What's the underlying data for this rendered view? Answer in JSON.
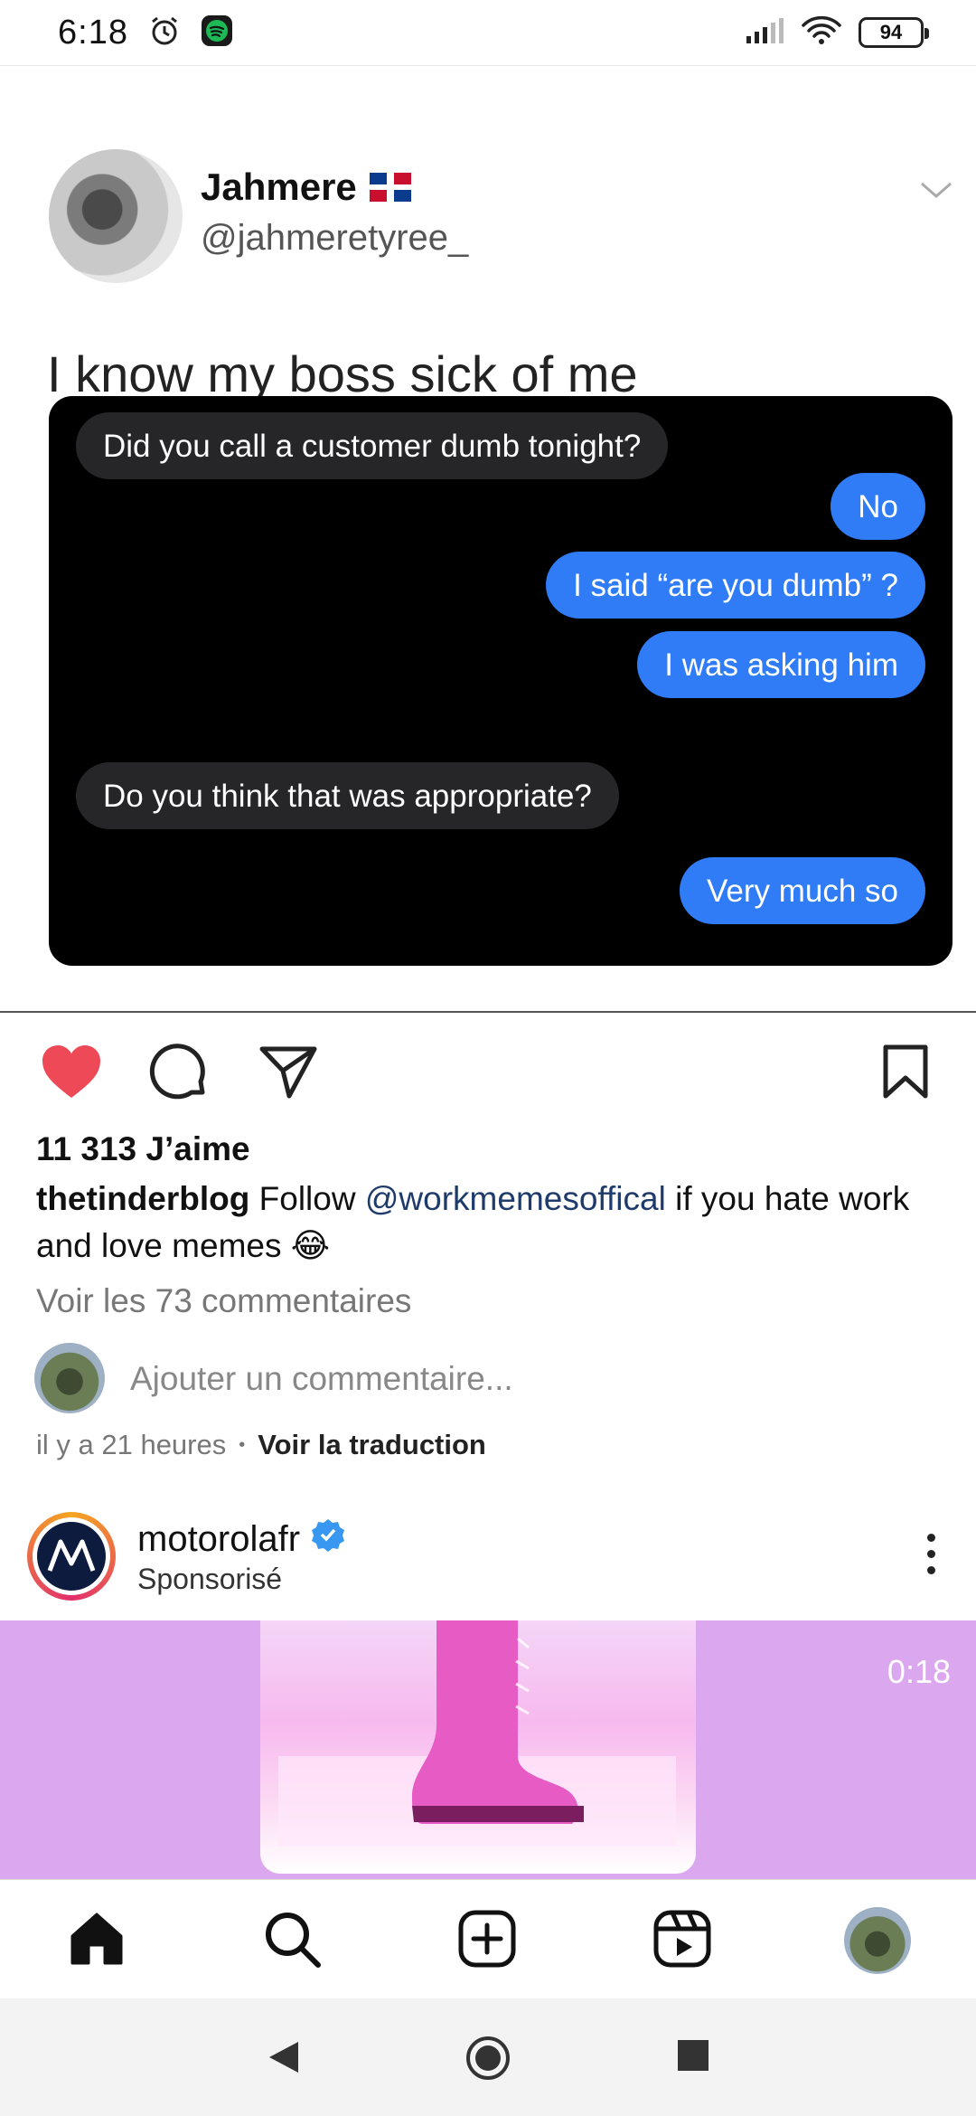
{
  "status_bar": {
    "time": "6:18",
    "battery": "94"
  },
  "tweet": {
    "name": "Jahmere",
    "handle": "@jahmeretyree_",
    "text": "I know my boss sick of me",
    "messages": [
      {
        "direction": "in",
        "text": "Did you call a customer dumb tonight?"
      },
      {
        "direction": "out",
        "text": "No"
      },
      {
        "direction": "out",
        "text": "I said “are you dumb” ?"
      },
      {
        "direction": "out",
        "text": "I was asking him"
      },
      {
        "direction": "in",
        "text": "Do you think that was appropriate?"
      },
      {
        "direction": "out",
        "text": "Very much so"
      }
    ]
  },
  "post": {
    "likes": "11 313 J’aime",
    "caption_user": "thetinderblog",
    "caption_pre": "Follow",
    "caption_mention": "@workmemesoffical",
    "caption_post": "if you hate work and love memes 😂",
    "view_comments": "Voir les 73 commentaires",
    "comment_placeholder": "Ajouter un commentaire...",
    "time_ago": "il y a 21 heures",
    "translate": "Voir la traduction",
    "liked_color": "#ed4956"
  },
  "sponsored": {
    "name": "motorolafr",
    "label": "Sponsorisé",
    "video_time": "0:18",
    "verified_color": "#3897f0"
  },
  "icons": {
    "status": [
      "alarm-icon",
      "spotify-icon",
      "signal-icon",
      "wifi-icon",
      "battery-icon"
    ],
    "actions": [
      "heart-icon",
      "comment-icon",
      "share-icon",
      "bookmark-icon"
    ],
    "nav": [
      "home-icon",
      "search-icon",
      "create-icon",
      "reels-icon",
      "profile-avatar"
    ],
    "system": [
      "back-icon",
      "home-button-icon",
      "recents-icon"
    ]
  }
}
